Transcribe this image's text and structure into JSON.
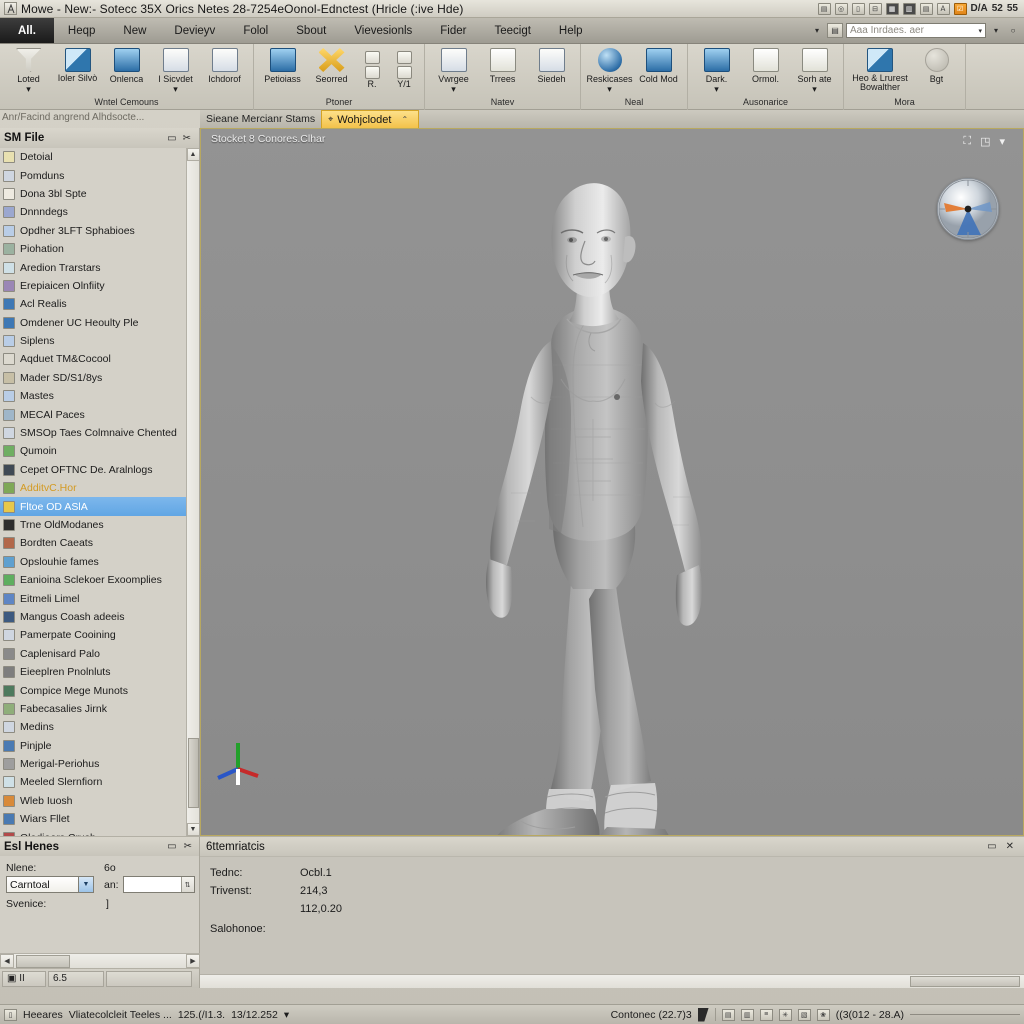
{
  "titlebar": {
    "logo_icon": "app-logo-icon",
    "title": "Mowe - New:- Sotecc 35X Orics Netes 28-7254eOonol-Ednctest (Hricle (:ive Hde)",
    "tray_icons": [
      {
        "name": "panel-layout-icon",
        "glyph": "▤"
      },
      {
        "name": "camera-icon",
        "glyph": "◎"
      },
      {
        "name": "page-icon",
        "glyph": "▯"
      },
      {
        "name": "link-icon",
        "glyph": "⊟"
      },
      {
        "name": "grid-dark-icon",
        "glyph": "▦",
        "style": "dark"
      },
      {
        "name": "table-icon",
        "glyph": "▥",
        "style": "dark"
      },
      {
        "name": "multi-window-icon",
        "glyph": "▤"
      },
      {
        "name": "text-icon",
        "glyph": "Ａ"
      },
      {
        "name": "checkbox-orange-icon",
        "glyph": "☑",
        "style": "orange"
      },
      {
        "name": "label-dw",
        "glyph": "D/A",
        "style": "plain"
      },
      {
        "name": "label-52",
        "glyph": "52",
        "style": "plain"
      },
      {
        "name": "label-55",
        "glyph": "55",
        "style": "plain"
      }
    ]
  },
  "menubar": {
    "tabs": [
      {
        "label": "All.",
        "active": true
      },
      {
        "label": "Heqp",
        "active": false
      },
      {
        "label": "New",
        "active": false
      },
      {
        "label": "Devieyv",
        "active": false
      },
      {
        "label": "Folol",
        "active": false
      },
      {
        "label": "Sbout",
        "active": false
      },
      {
        "label": "Vievesionls",
        "active": false
      },
      {
        "label": "Fider",
        "active": false
      },
      {
        "label": "Teecigt",
        "active": false
      },
      {
        "label": "Help",
        "active": false
      }
    ],
    "overflow_caret": "▾",
    "quick_icon": "doc-index-icon",
    "search_value": "",
    "search_placeholder": "Aaa Inrdaes. aer",
    "search_caret": "▾",
    "after_caret": "▾",
    "help_glyph": "○"
  },
  "ribbon": {
    "groups": [
      {
        "title": "Wntel Cemouns",
        "buttons": [
          {
            "label": "Loted",
            "icon": "funnel-icon",
            "shape": "funnel",
            "dropdown": true
          },
          {
            "label": "Ioler Silvò",
            "icon": "tools-icon",
            "shape": "pen",
            "dropdown": false
          },
          {
            "label": "Onlenca",
            "icon": "globe-icon",
            "shape": "blue",
            "dropdown": false
          },
          {
            "label": "I Sicvdet",
            "icon": "screen-share-icon",
            "shape": "win",
            "dropdown": true
          },
          {
            "label": "Ichdorof",
            "icon": "monitor-icon",
            "shape": "win",
            "dropdown": false
          }
        ]
      },
      {
        "title": "Ptoner",
        "buttons": [
          {
            "label": "Petioiass",
            "icon": "refresh-icon",
            "shape": "blue",
            "dropdown": false
          },
          {
            "label": "Seorred",
            "icon": "scatter-x-icon",
            "shape": "xshape",
            "dropdown": false
          }
        ],
        "mini": [
          {
            "label": "R.",
            "icon": "align-top-icon"
          },
          {
            "label": "Y/1",
            "icon": "align-mid-icon"
          }
        ]
      },
      {
        "title": "Natev",
        "buttons": [
          {
            "label": "Vwrgee",
            "icon": "window-icon",
            "shape": "win",
            "dropdown": true
          },
          {
            "label": "Trrees",
            "icon": "list-doc-icon",
            "shape": "doc",
            "dropdown": false
          },
          {
            "label": "Siedeh",
            "icon": "sketch-icon",
            "shape": "win",
            "dropdown": false
          }
        ]
      },
      {
        "title": "Neal",
        "buttons": [
          {
            "label": "Reskicases",
            "icon": "blue-orb-icon",
            "shape": "blueorb",
            "dropdown": true
          },
          {
            "label": "Cold Mod",
            "icon": "mod-icon",
            "shape": "blue",
            "dropdown": false
          }
        ]
      },
      {
        "title": "Ausonarice",
        "buttons": [
          {
            "label": "Dark.",
            "icon": "layers-icon",
            "shape": "blue",
            "dropdown": true
          },
          {
            "label": "Ormol.",
            "icon": "page-turn-icon",
            "shape": "doc",
            "dropdown": false
          },
          {
            "label": "Sorh ate",
            "icon": "sort-icon",
            "shape": "doc",
            "dropdown": true
          }
        ]
      },
      {
        "title": "Mora",
        "buttons": [
          {
            "label": "Heo & Lrurest Bowalther",
            "icon": "paint-icon",
            "shape": "pen",
            "dropdown": false
          },
          {
            "label": "Bgt",
            "icon": "grey-orb-icon",
            "shape": "greyorb",
            "dropdown": false
          }
        ]
      }
    ],
    "close_glyph": "✕"
  },
  "dockstrip": {
    "overtext": "Anr/Facind angrend  Alhdsocte...",
    "label": "Sieane Mercianr Stams",
    "tab_icon": "model-icon",
    "tab_label": "Wohjclodet",
    "tab_caret": "⌃"
  },
  "sidebar": {
    "header": {
      "title": "SM File",
      "icons": [
        {
          "name": "minimize-panel-icon",
          "glyph": "▭"
        },
        {
          "name": "float-panel-icon",
          "glyph": "✂"
        }
      ]
    },
    "items": [
      {
        "label": "Detoial",
        "icon": "file-icon",
        "color": "#e8e0b0"
      },
      {
        "label": "Pomduns",
        "icon": "chart-icon",
        "color": "#cfd6e0"
      },
      {
        "label": "Dona 3bl Spte",
        "icon": "book-icon",
        "color": "#eeeae0"
      },
      {
        "label": "Dnnndegs",
        "icon": "diamond-icon",
        "color": "#9ba7cf"
      },
      {
        "label": "Opdher 3LFT Sphabioes",
        "icon": "panel-icon",
        "color": "#b9cde6"
      },
      {
        "label": "Piohation",
        "icon": "tree-icon",
        "color": "#9bb2a0"
      },
      {
        "label": "Aredion Trarstars",
        "icon": "box-icon",
        "color": "#cfe0e6"
      },
      {
        "label": "Erepiaicen Olnfiity",
        "icon": "sphere-icon",
        "color": "#9a86b5"
      },
      {
        "label": "Acl Realis",
        "icon": "blue-sphere-icon",
        "color": "#3e78b4"
      },
      {
        "label": "Omdener UC Heoulty Ple",
        "icon": "blue-sphere-icon",
        "color": "#3e78b4"
      },
      {
        "label": "Siplens",
        "icon": "page-icon",
        "color": "#b9cde6"
      },
      {
        "label": "Aqduet TM&Cocool",
        "icon": "doc-icon",
        "color": "#dcd9cf"
      },
      {
        "label": "Mader SD/S1/8ys",
        "icon": "gear-icon",
        "color": "#c7bfa6"
      },
      {
        "label": "Mastes",
        "icon": "panel-icon",
        "color": "#b9cde6"
      },
      {
        "label": "MECAl Paces",
        "icon": "tray-icon",
        "color": "#9fb6c9"
      },
      {
        "label": "SMSOp Taes Colmnaive Chented",
        "icon": "lock-icon",
        "color": "#cfd6e0"
      },
      {
        "label": "Qumoin",
        "icon": "earth-icon",
        "color": "#6fae62"
      },
      {
        "label": "Cepet OFTNC De. Aralnlogs",
        "icon": "keyboard-icon",
        "color": "#404a55"
      },
      {
        "label": "AdditvC.Hor",
        "icon": "leaf-icon",
        "color": "#7fa857",
        "orange": true
      },
      {
        "label": "Fltoe OD ASlA",
        "icon": "image-icon",
        "color": "#e8c84a",
        "selected": true
      },
      {
        "label": "Trne OldModanes",
        "icon": "play-icon",
        "color": "#2e2e2e"
      },
      {
        "label": "Bordten Caeats",
        "icon": "bricks-icon",
        "color": "#b2684a"
      },
      {
        "label": "Opslouhie fames",
        "icon": "cycle-icon",
        "color": "#5fa0cf"
      },
      {
        "label": "Eanioina Sclekoer Exoomplies",
        "icon": "green-doc-icon",
        "color": "#5fae5f"
      },
      {
        "label": "Eitmeli Limel",
        "icon": "bar-icon",
        "color": "#5f86c4"
      },
      {
        "label": "Mangus Coash adeeis",
        "icon": "dark-sphere-icon",
        "color": "#3d5a80"
      },
      {
        "label": "Pamerpate Cooining",
        "icon": "people-icon",
        "color": "#cfd6e0"
      },
      {
        "label": "Caplenisard Palo",
        "icon": "wrench-icon",
        "color": "#8a8a8a"
      },
      {
        "label": "Eieeplren Pnolnluts",
        "icon": "disc-icon",
        "color": "#7e7e7e"
      },
      {
        "label": "Compice Mege Munots",
        "icon": "mesh-icon",
        "color": "#4e7a5e"
      },
      {
        "label": "Fabecasalies Jirnk",
        "icon": "tree2-icon",
        "color": "#8fae7a"
      },
      {
        "label": "Medins",
        "icon": "window-icon",
        "color": "#cfd6e0"
      },
      {
        "label": "Pinjple",
        "icon": "blue-panel-icon",
        "color": "#4a7ab2"
      },
      {
        "label": "Merigal-Periohus",
        "icon": "strip-icon",
        "color": "#9e9e9e"
      },
      {
        "label": "Meeled Slernfiorn",
        "icon": "frame-icon",
        "color": "#cfe0e6"
      },
      {
        "label": "Wleb Iuosh",
        "icon": "orange-grid-icon",
        "color": "#d88a3a"
      },
      {
        "label": "Wiars Fllet",
        "icon": "blue-box-icon",
        "color": "#4a7ab2"
      },
      {
        "label": "Oladiaers Crush",
        "icon": "red-icon",
        "color": "#b24a4a"
      }
    ],
    "scroll": {
      "up": "▲",
      "down": "▼"
    }
  },
  "viewport": {
    "label": "Stocket 8 Conores.Clhar",
    "tools": [
      {
        "name": "fit-view-icon",
        "glyph": "⛶"
      },
      {
        "name": "shading-icon",
        "glyph": "◳"
      },
      {
        "name": "view-menu-caret-icon",
        "glyph": "▾"
      }
    ],
    "navwheel_name": "view-navigation-wheel",
    "axis_gizmo": {
      "name": "axis-gizmo",
      "x": "red",
      "y": "green",
      "z": "blue"
    },
    "model_name": "character-3d-model"
  },
  "bottom_left": {
    "header": {
      "title": "Esl Henes",
      "icons": [
        {
          "name": "minimize-panel-icon",
          "glyph": "▭"
        },
        {
          "name": "float-panel-icon",
          "glyph": "✂"
        }
      ]
    },
    "field1_label": "Nlene:",
    "field1_value": "Carntoal",
    "field2_label": "6o",
    "field2_prefix": "an:",
    "field2_value": "",
    "field3_label": "Svenice:",
    "field3_value": "]",
    "hscroll": {
      "left": "◀",
      "right": "▶"
    },
    "footer_cells": [
      {
        "name": "status-cell-icons",
        "label": "▣ II"
      },
      {
        "name": "status-cell-value",
        "label": "6.5"
      },
      {
        "name": "status-cell-blank",
        "label": ""
      }
    ]
  },
  "bottom_right": {
    "header": {
      "title": "6ttemriatcis",
      "icons": [
        {
          "name": "minimize-panel-icon",
          "glyph": "▭"
        },
        {
          "name": "close-panel-icon",
          "glyph": "✕"
        }
      ]
    },
    "rows": [
      {
        "key": "Tednc:",
        "value": "Ocbl.1"
      },
      {
        "key": "Trivenst:",
        "value": "214,3"
      },
      {
        "key": "",
        "value": "112,0.20"
      },
      {
        "key": "Salohonoe:",
        "value": ""
      }
    ]
  },
  "statusbar": {
    "left_icon": "doc-icon",
    "left_label": "Heeares",
    "mid_label": "Vliatecolcleit  Teeles ...",
    "coord1": "125.(/I1.3.",
    "coord2": "13/12.252",
    "coord_caret": "▾",
    "right_label": "Contonec (22.7)3",
    "right_icons": [
      {
        "name": "snap-icon",
        "glyph": "▤"
      },
      {
        "name": "grid-icon",
        "glyph": "▥"
      },
      {
        "name": "ortho-icon",
        "glyph": "≡"
      },
      {
        "name": "polar-icon",
        "glyph": "✳"
      },
      {
        "name": "osnap-icon",
        "glyph": "▧"
      },
      {
        "name": "wheel-icon",
        "glyph": "❀"
      }
    ],
    "right_coords": "((3(012 - 28.A)"
  }
}
